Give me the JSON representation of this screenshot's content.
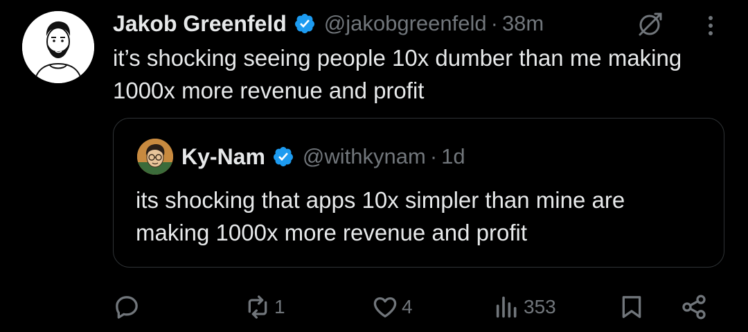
{
  "tweet": {
    "author_name": "Jakob Greenfeld",
    "handle": "@jakobgreenfeld",
    "separator": "·",
    "time": "38m",
    "text": "it’s shocking seeing people 10x dumber than me making 1000x more revenue and profit"
  },
  "quote": {
    "author_name": "Ky-Nam",
    "handle": "@withkynam",
    "separator": "·",
    "time": "1d",
    "text": "its shocking that apps 10x simpler than mine are making 1000x more revenue and profit"
  },
  "actions": {
    "reply_count": "",
    "retweet_count": "1",
    "like_count": "4",
    "views_count": "353"
  },
  "colors": {
    "background": "#000000",
    "text": "#e7e9ea",
    "muted": "#71767b",
    "verified": "#1d9bf0",
    "border": "#2f3336"
  },
  "icons": [
    "avatar",
    "verified-badge-icon",
    "grok-icon",
    "more-icon",
    "reply-icon",
    "retweet-icon",
    "like-icon",
    "views-icon",
    "bookmark-icon",
    "share-icon"
  ]
}
